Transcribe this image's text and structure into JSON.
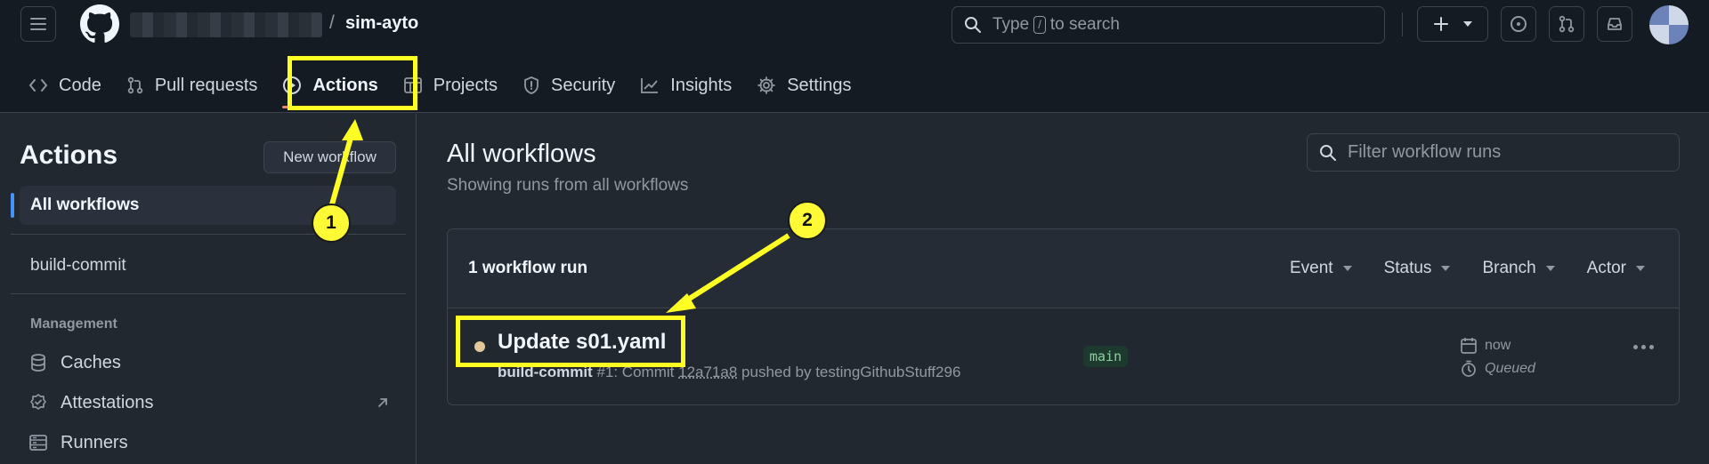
{
  "header": {
    "repo_name": "sim-ayto",
    "separator": "/",
    "search_prefix": "Type",
    "search_key": "/",
    "search_suffix": "to search"
  },
  "nav": {
    "items": [
      {
        "label": "Code",
        "icon": "code-icon"
      },
      {
        "label": "Pull requests",
        "icon": "pull-request-icon"
      },
      {
        "label": "Actions",
        "icon": "play-circle-icon",
        "active": true
      },
      {
        "label": "Projects",
        "icon": "table-icon"
      },
      {
        "label": "Security",
        "icon": "shield-icon"
      },
      {
        "label": "Insights",
        "icon": "graph-icon"
      },
      {
        "label": "Settings",
        "icon": "gear-icon"
      }
    ]
  },
  "sidebar": {
    "title": "Actions",
    "new_workflow": "New workflow",
    "all_workflows": "All workflows",
    "workflow_item": "build-commit",
    "management_heading": "Management",
    "links": [
      {
        "label": "Caches",
        "icon": "database-icon"
      },
      {
        "label": "Attestations",
        "icon": "verified-icon"
      },
      {
        "label": "Runners",
        "icon": "server-icon"
      }
    ]
  },
  "main": {
    "title": "All workflows",
    "subtitle": "Showing runs from all workflows",
    "filter_placeholder": "Filter workflow runs",
    "run_count": "1 workflow run",
    "filters": [
      "Event",
      "Status",
      "Branch",
      "Actor"
    ],
    "run": {
      "title": "Update s01.yaml",
      "workflow": "build-commit",
      "number": "#1: Commit",
      "sha": "12a71a8",
      "pushed_by": "pushed by testingGithubStuff296",
      "branch": "main",
      "time": "now",
      "status": "Queued"
    }
  },
  "annotations": {
    "badge_1": "1",
    "badge_2": "2",
    "color": "#ffff24"
  }
}
